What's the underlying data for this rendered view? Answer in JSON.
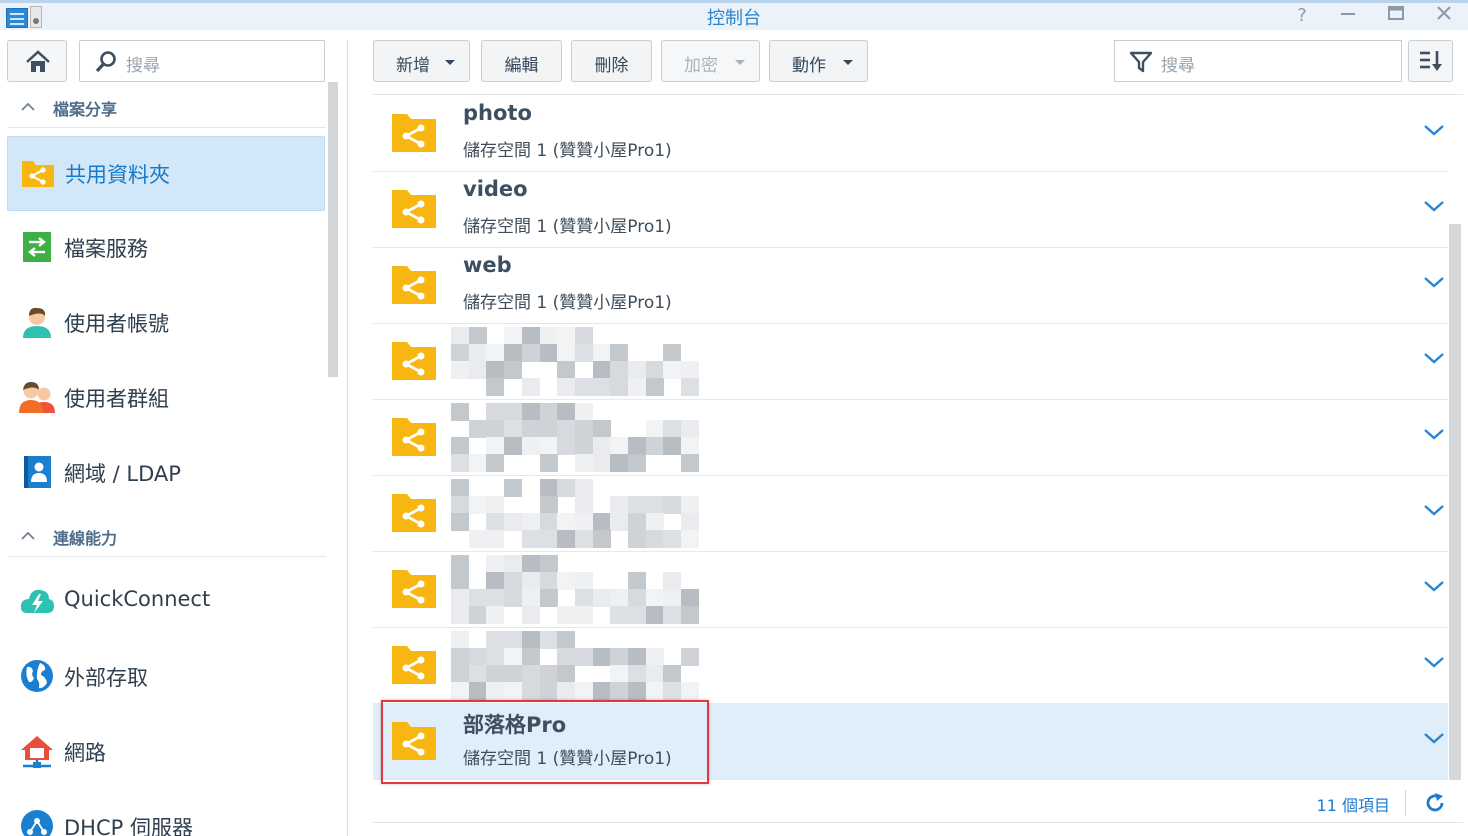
{
  "window": {
    "title": "控制台",
    "help_label": "?",
    "minimize_label": "−",
    "maximize_label": "□",
    "close_label": "✕"
  },
  "sidebar": {
    "search_placeholder": "搜尋",
    "sections": [
      {
        "label": "檔案分享",
        "items": [
          {
            "label": "共用資料夾",
            "icon": "shared-folder-icon",
            "active": true
          },
          {
            "label": "檔案服務",
            "icon": "file-services-icon"
          },
          {
            "label": "使用者帳號",
            "icon": "user-icon"
          },
          {
            "label": "使用者群組",
            "icon": "group-icon"
          },
          {
            "label": "網域 / LDAP",
            "icon": "domain-ldap-icon"
          }
        ]
      },
      {
        "label": "連線能力",
        "items": [
          {
            "label": "QuickConnect",
            "icon": "quickconnect-icon"
          },
          {
            "label": "外部存取",
            "icon": "globe-icon"
          },
          {
            "label": "網路",
            "icon": "network-icon"
          },
          {
            "label": "DHCP 伺服器",
            "icon": "dhcp-icon"
          }
        ]
      }
    ]
  },
  "toolbar": {
    "create_label": "新增",
    "edit_label": "編輯",
    "delete_label": "刪除",
    "encrypt_label": "加密",
    "action_label": "動作",
    "search_placeholder": "搜尋"
  },
  "folders": [
    {
      "name": "photo",
      "location": "儲存空間 1 (贊贊小屋Pro1)"
    },
    {
      "name": "video",
      "location": "儲存空間 1 (贊贊小屋Pro1)"
    },
    {
      "name": "web",
      "location": "儲存空間 1 (贊贊小屋Pro1)"
    },
    {
      "name": "",
      "location": "",
      "redacted": true
    },
    {
      "name": "",
      "location": "",
      "redacted": true
    },
    {
      "name": "",
      "location": "",
      "redacted": true
    },
    {
      "name": "",
      "location": "",
      "redacted": true
    },
    {
      "name": "",
      "location": "",
      "redacted": true
    },
    {
      "name": "部落格Pro",
      "location": "儲存空間 1 (贊贊小屋Pro1)",
      "selected": true
    }
  ],
  "footer": {
    "item_count": "11 個項目"
  },
  "colors": {
    "accent": "#1d7bd0",
    "folder": "#f8b610",
    "selection": "#e0eefa",
    "highlight_box": "#e0383d"
  }
}
